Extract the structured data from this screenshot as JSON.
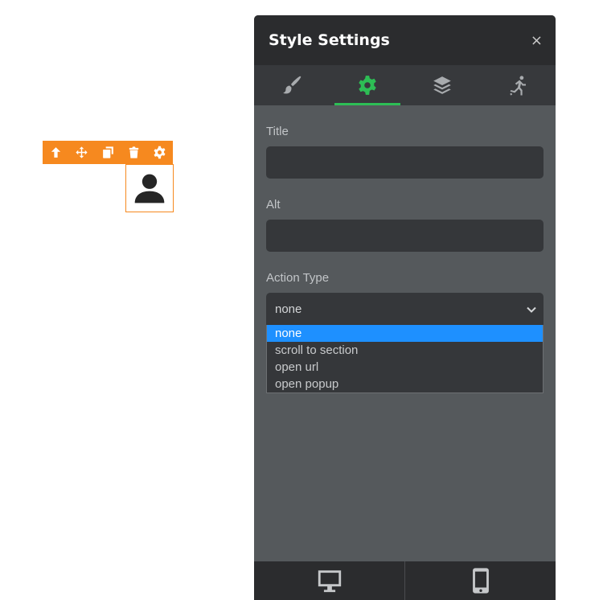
{
  "toolbar": {
    "icons": [
      "arrow-up-icon",
      "move-icon",
      "copy-icon",
      "trash-icon",
      "gear-icon"
    ],
    "color": "#f6891f"
  },
  "element": {
    "icon": "user-icon"
  },
  "panel": {
    "title": "Style Settings",
    "close": "×",
    "tabs": [
      {
        "icon": "brush-icon",
        "active": false
      },
      {
        "icon": "gear-icon",
        "active": true
      },
      {
        "icon": "layers-icon",
        "active": false
      },
      {
        "icon": "animation-icon",
        "active": false
      }
    ],
    "active_color": "#2dbe55",
    "fields": {
      "title_label": "Title",
      "title_value": "",
      "alt_label": "Alt",
      "alt_value": "",
      "action_label": "Action Type",
      "action_value": "none",
      "action_options": [
        "none",
        "scroll to section",
        "open url",
        "open popup"
      ]
    },
    "footer": {
      "devices": [
        "desktop-icon",
        "mobile-icon"
      ]
    }
  }
}
